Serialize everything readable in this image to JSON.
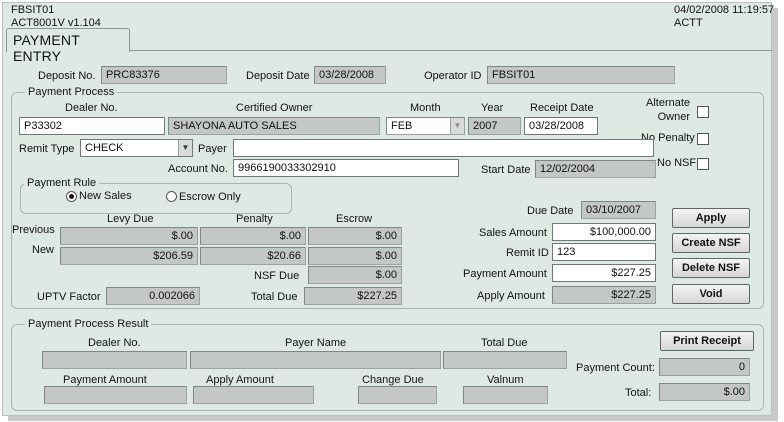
{
  "header": {
    "screen_id": "FBSIT01",
    "app_version": "ACT8001V  v1.104",
    "datetime": "04/02/2008 11:19:57",
    "app_code": "ACTT"
  },
  "tab": {
    "label": "PAYMENT ENTRY"
  },
  "deposit": {
    "no_label": "Deposit No.",
    "no_value": "PRC83376",
    "date_label": "Deposit Date",
    "date_value": "03/28/2008",
    "operator_label": "Operator ID",
    "operator_value": "FBSIT01"
  },
  "payment_process": {
    "title": "Payment Process",
    "dealer_label": "Dealer No.",
    "dealer_value": "P33302",
    "owner_label": "Certified Owner",
    "owner_value": "SHAYONA AUTO SALES",
    "month_label": "Month",
    "month_value": "FEB",
    "year_label": "Year",
    "year_value": "2007",
    "receipt_label": "Receipt Date",
    "receipt_value": "03/28/2008",
    "alternate_owner_label": "Alternate\nOwner",
    "alternate_owner_line1": "Alternate",
    "alternate_owner_line2": "Owner",
    "no_penalty_label": "No Penalty",
    "no_nsf_label": "No NSF",
    "remit_type_label": "Remit Type",
    "remit_type_value": "CHECK",
    "payer_label": "Payer",
    "payer_value": "",
    "account_label": "Account No.",
    "account_value": "9966190033302910",
    "start_date_label": "Start Date",
    "start_date_value": "12/02/2004",
    "payment_rule_title": "Payment Rule",
    "rule_new_sales": "New Sales",
    "rule_escrow_only": "Escrow Only",
    "rule_selected": "New Sales",
    "levy_due_label": "Levy Due",
    "penalty_label": "Penalty",
    "escrow_label": "Escrow",
    "previous_label": "Previous",
    "new_label": "New",
    "previous_levy": "$.00",
    "previous_penalty": "$.00",
    "previous_escrow": "$.00",
    "new_levy": "$206.59",
    "new_penalty": "$20.66",
    "new_escrow": "$.00",
    "nsf_due_label": "NSF Due",
    "nsf_due_value": "$.00",
    "uptv_label": "UPTV Factor",
    "uptv_value": "0.002066",
    "total_due_label": "Total Due",
    "total_due_value": "$227.25",
    "due_date_label": "Due Date",
    "due_date_value": "03/10/2007",
    "sales_amount_label": "Sales Amount",
    "sales_amount_value": "$100,000.00",
    "remit_id_label": "Remit ID",
    "remit_id_value": "123",
    "payment_amount_label": "Payment Amount",
    "payment_amount_value": "$227.25",
    "apply_amount_label": "Apply Amount",
    "apply_amount_value": "$227.25"
  },
  "buttons": {
    "apply": "Apply",
    "create_nsf": "Create NSF",
    "delete_nsf": "Delete NSF",
    "void": "Void",
    "print_receipt": "Print Receipt"
  },
  "result": {
    "title": "Payment Process Result",
    "dealer_label": "Dealer No.",
    "payer_name_label": "Payer Name",
    "total_due_label": "Total Due",
    "payment_amount_label": "Payment Amount",
    "apply_amount_label": "Apply Amount",
    "change_due_label": "Change Due",
    "valnum_label": "Valnum",
    "payment_count_label": "Payment Count:",
    "payment_count_value": "0",
    "total_label": "Total:",
    "total_value": "$.00"
  }
}
